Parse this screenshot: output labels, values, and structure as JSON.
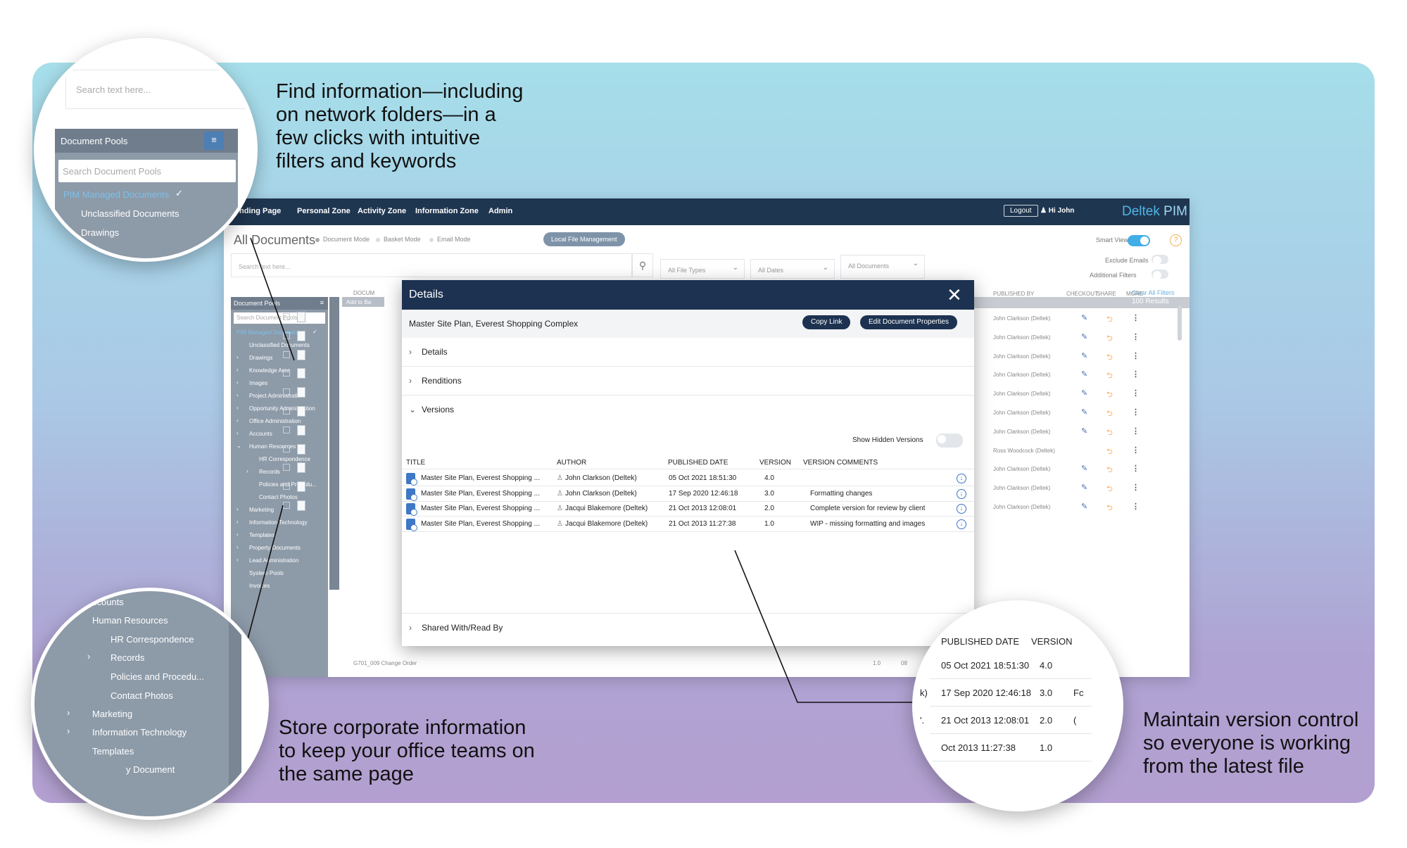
{
  "captions": {
    "find": "Find information—including\non network folders—in a\nfew clicks with intuitive\nfilters and keywords",
    "store": "Store corporate information\nto keep your office teams on\nthe same page",
    "version": "Maintain version control\nso everyone is working\nfrom the latest file"
  },
  "topbar": {
    "nav": [
      "nding Page",
      "Personal Zone",
      "Activity Zone",
      "Information Zone",
      "Admin"
    ],
    "logout": "Logout",
    "user": "Hi John",
    "brand": "Deltek",
    "brand_suffix": "PIM"
  },
  "header": {
    "title": "All Documents",
    "modes": [
      "Document Mode",
      "Basket Mode",
      "Email Mode",
      "Local File Management"
    ],
    "smart_view": "Smart View",
    "help": "?"
  },
  "search": {
    "placeholder": "Search text here...",
    "file_types": "All File Types",
    "dates": "All Dates",
    "documents": "All Documents",
    "exclude_emails": "Exclude Emails",
    "additional_filters": "Additional Filters",
    "clear": "Clear All Filters",
    "results": "100  Results"
  },
  "sidebar": {
    "title": "Document Pools",
    "search_placeholder": "Search Document Pools",
    "items": [
      "PIM Managed Documents",
      "Unclassified Documents",
      "Drawings",
      "Knowledge Area",
      "Images",
      "Project Administration",
      "Opportunity Administration",
      "Office Administration",
      "Accounts",
      "Human Resources",
      "HR Correspondence",
      "Records",
      "Policies and Procedu...",
      "Contact Photos",
      "Marketing",
      "Information Technology",
      "Templates",
      "Property Documents",
      "Lead Administration",
      "System Pools",
      "Invoices"
    ]
  },
  "list": {
    "headers": {
      "document": "DOCUM",
      "published_by": "PUBLISHED BY",
      "checkout": "CHECKOUT",
      "share": "SHARE",
      "more": "MORE"
    },
    "add_to_basket": "Add to Ba",
    "published_by": [
      "John Clarkson (Deltek)",
      "John Clarkson (Deltek)",
      "John Clarkson (Deltek)",
      "John Clarkson (Deltek)",
      "John Clarkson (Deltek)",
      "John Clarkson (Deltek)",
      "John Clarkson (Deltek)",
      "Ross Woodcock (Deltek)",
      "John Clarkson (Deltek)",
      "John Clarkson (Deltek)",
      "John Clarkson (Deltek)"
    ],
    "last_row": {
      "name": "G701_009 Change Order",
      "version": "1.0",
      "date": "08"
    }
  },
  "modal": {
    "title": "Details",
    "doc_name": "Master Site Plan, Everest Shopping Complex",
    "copy_link": "Copy Link",
    "edit_props": "Edit Document Properties",
    "sections": [
      "Details",
      "Renditions",
      "Versions",
      "Shared With/Read By"
    ],
    "show_hidden": "Show Hidden Versions",
    "columns": [
      "TITLE",
      "AUTHOR",
      "PUBLISHED DATE",
      "VERSION",
      "VERSION COMMENTS"
    ],
    "versions": [
      {
        "title": "Master Site Plan, Everest Shopping ...",
        "author": "John Clarkson (Deltek)",
        "date": "05 Oct 2021 18:51:30",
        "version": "4.0",
        "comment": ""
      },
      {
        "title": "Master Site Plan, Everest Shopping ...",
        "author": "John Clarkson (Deltek)",
        "date": "17 Sep 2020 12:46:18",
        "version": "3.0",
        "comment": "Formatting changes"
      },
      {
        "title": "Master Site Plan, Everest Shopping ...",
        "author": "Jacqui Blakemore (Deltek)",
        "date": "21 Oct 2013 12:08:01",
        "version": "2.0",
        "comment": "Complete version for review by client"
      },
      {
        "title": "Master Site Plan, Everest Shopping ...",
        "author": "Jacqui Blakemore (Deltek)",
        "date": "21 Oct 2013 11:27:38",
        "version": "1.0",
        "comment": "WIP - missing formatting and images"
      }
    ]
  },
  "zoom1": {
    "search_placeholder": "Search text here...",
    "pools_title": "Document Pools",
    "pools_search": "Search Document Pools",
    "items": [
      "PIM Managed Documents",
      "Unclassified Documents",
      "Drawings"
    ]
  },
  "zoom2": {
    "items": [
      "ccounts",
      "Human Resources",
      "HR Correspondence",
      "Records",
      "Policies and Procedu...",
      "Contact Photos",
      "Marketing",
      "Information Technology",
      "Templates",
      "y Document"
    ]
  },
  "zoom3": {
    "headers": [
      "PUBLISHED DATE",
      "VERSION"
    ],
    "rows": [
      {
        "prefix": ")",
        "date": "05 Oct 2021 18:51:30",
        "version": "4.0",
        "suffix": ""
      },
      {
        "prefix": "k)",
        "date": "17 Sep 2020 12:46:18",
        "version": "3.0",
        "suffix": "Fc"
      },
      {
        "prefix": "'.",
        "date": "21 Oct 2013 12:08:01",
        "version": "2.0",
        "suffix": "("
      },
      {
        "prefix": "",
        "date": "Oct 2013 11:27:38",
        "version": "1.0",
        "suffix": ""
      }
    ]
  },
  "colors": {
    "navy": "#1d3251",
    "accent": "#43aee6",
    "share_orange": "#f3a84a"
  },
  "icons": [
    "search-icon",
    "close-icon",
    "chevron-right-icon",
    "chevron-down-icon",
    "pencil-icon",
    "share-icon",
    "more-icon",
    "download-icon",
    "user-icon",
    "check-icon",
    "collapse-icon",
    "help-icon"
  ]
}
